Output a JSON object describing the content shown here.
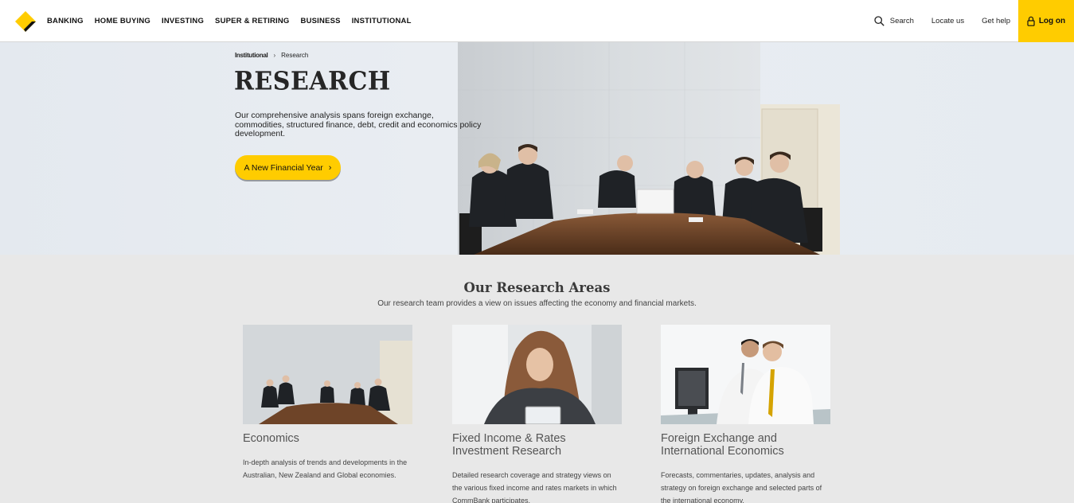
{
  "header": {
    "nav": [
      "BANKING",
      "HOME BUYING",
      "INVESTING",
      "SUPER & RETIRING",
      "BUSINESS",
      "INSTITUTIONAL"
    ],
    "search_label": "Search",
    "locate_label": "Locate us",
    "help_label": "Get help",
    "login_label": "Log on",
    "brand_color": "#ffcc00"
  },
  "hero": {
    "breadcrumb": {
      "parent": "Institutional",
      "current": "Research"
    },
    "title": "RESEARCH",
    "description": "Our comprehensive analysis spans foreign exchange, commodities, structured finance, debt, credit and economics policy development.",
    "button_label": "A New Financial Year"
  },
  "areas": {
    "title": "Our Research Areas",
    "subtitle": "Our research team provides a view on issues affecting the economy and financial markets.",
    "cards": [
      {
        "title": "Economics",
        "description": "In-depth analysis of trends and developments in the Australian, New Zealand and Global economies."
      },
      {
        "title": "Fixed Income & Rates Investment Research",
        "description": "Detailed research coverage and strategy views on the various fixed income and rates markets in which CommBank participates."
      },
      {
        "title": "Foreign Exchange and International Economics",
        "description": "Forecasts, commentaries, updates, analysis and strategy on foreign exchange and selected parts of the international economy."
      }
    ]
  }
}
